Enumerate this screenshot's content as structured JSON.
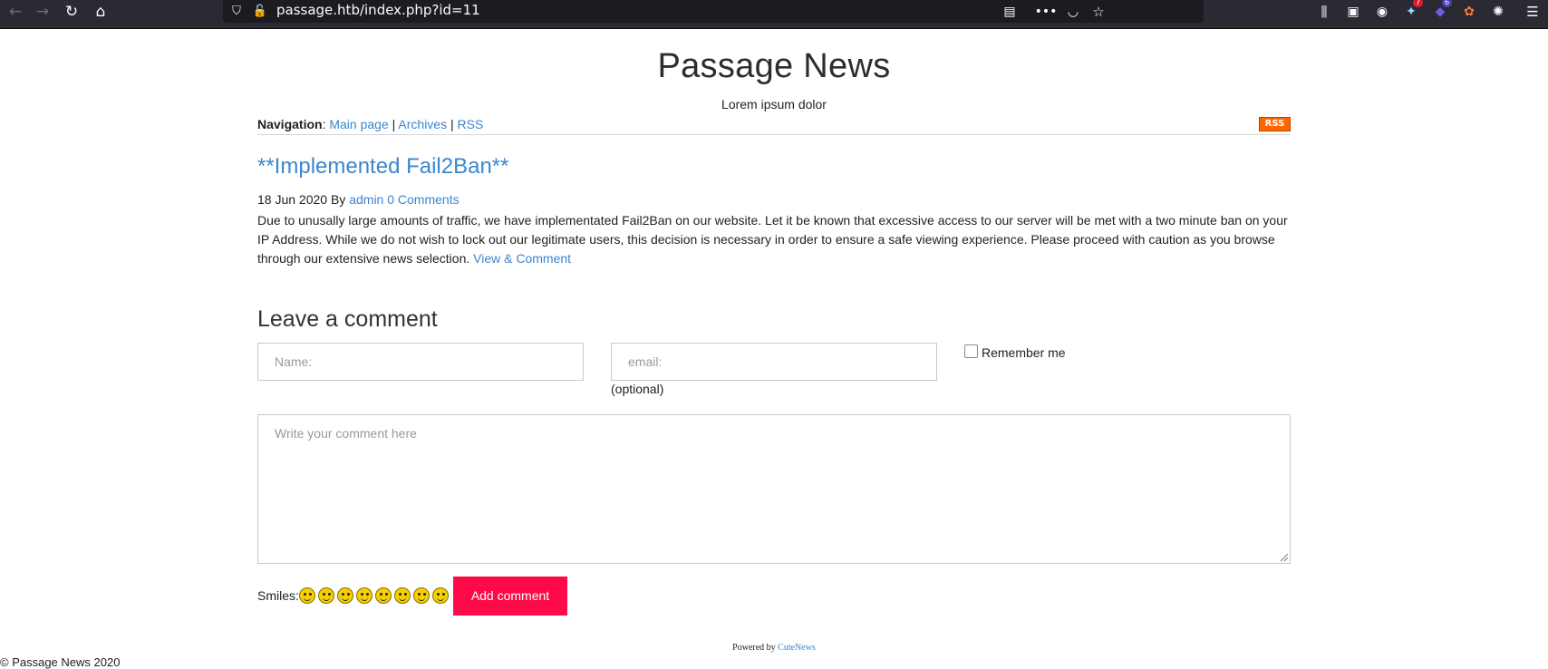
{
  "browser": {
    "url": "passage.htb/index.php?id=11",
    "icons": [
      "back-icon",
      "forward-icon",
      "reload-icon",
      "home-icon",
      "shield-icon",
      "insecure-lock-icon",
      "reader-view-icon",
      "more-icon",
      "pocket-icon",
      "bookmark-star-icon",
      "library-icon",
      "sidebar-icon",
      "account-icon",
      "extension-icon",
      "extension-icon",
      "extension-icon",
      "extension-icon",
      "menu-icon"
    ],
    "badges": [
      "7",
      "6"
    ]
  },
  "page": {
    "title": "Passage News",
    "subtitle": "Lorem ipsum dolor",
    "nav": {
      "label": "Navigation",
      "items": [
        "Main page",
        "Archives",
        "RSS"
      ],
      "rss_badge": "RSS"
    }
  },
  "post": {
    "title": "**Implemented Fail2Ban**",
    "date": "18 Jun 2020",
    "by": "By",
    "author": "admin",
    "comments": "0 Comments",
    "body": "Due to unusally large amounts of traffic, we have implementated Fail2Ban on our website. Let it be known that excessive access to our server will be met with a two minute ban on your IP Address. While we do not wish to lock out our legitimate users, this decision is necessary in order to ensure a safe viewing experience. Please proceed with caution as you browse through our extensive news selection.",
    "view_link": "View & Comment"
  },
  "comment_form": {
    "heading": "Leave a comment",
    "name_placeholder": "Name:",
    "email_placeholder": "email:",
    "optional": "(optional)",
    "remember": "Remember me",
    "comment_placeholder": "Write your comment here",
    "smiles_label": "Smiles:",
    "smiles_count": 8,
    "submit": "Add comment"
  },
  "footer": {
    "powered_by": "Powered by",
    "powered_link": "CuteNews",
    "copyright": "© Passage News 2020"
  },
  "colors": {
    "link": "#3b86d0",
    "button": "#ff0a48",
    "chrome": "#2b2a33",
    "rss": "#ff6600"
  }
}
